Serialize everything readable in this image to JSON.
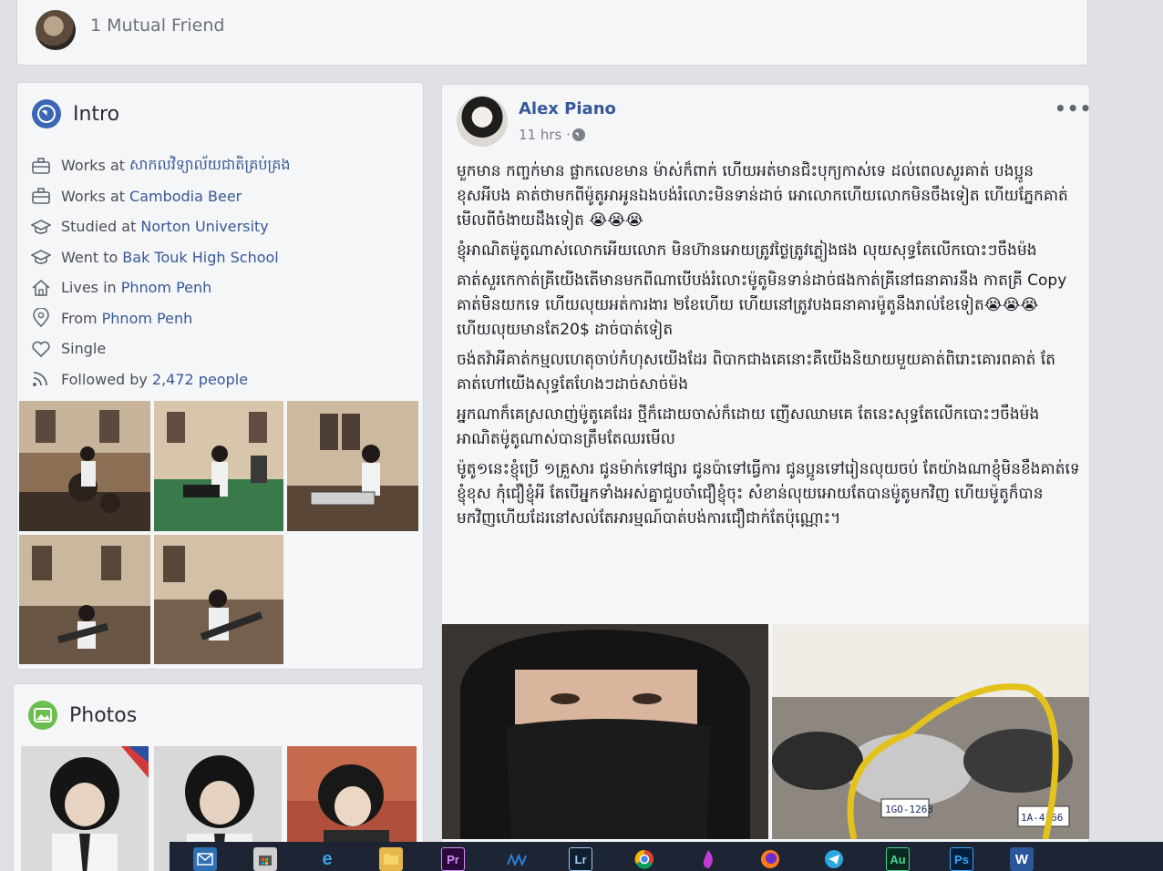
{
  "mutual": {
    "text": "1 Mutual Friend"
  },
  "intro": {
    "title": "Intro",
    "items": [
      {
        "icon": "briefcase-icon",
        "prefix": "Works at",
        "link": "សាកលវិទ្យាល័យជាតិគ្រប់គ្រង"
      },
      {
        "icon": "briefcase-icon",
        "prefix": "Works at",
        "link": "Cambodia Beer"
      },
      {
        "icon": "graduation-cap-icon",
        "prefix": "Studied at",
        "link": "Norton University"
      },
      {
        "icon": "graduation-cap-icon",
        "prefix": "Went to",
        "link": "Bak Touk High School"
      },
      {
        "icon": "home-icon",
        "prefix": "Lives in",
        "link": "Phnom Penh"
      },
      {
        "icon": "location-pin-icon",
        "prefix": "From",
        "link": "Phnom Penh"
      },
      {
        "icon": "heart-icon",
        "prefix": "Single",
        "link": ""
      },
      {
        "icon": "rss-feed-icon",
        "prefix": "Followed by",
        "link": "2,472 people"
      }
    ]
  },
  "photos": {
    "title": "Photos"
  },
  "post": {
    "author": "Alex Piano",
    "time": "11 hrs ·",
    "more": "•••",
    "paragraphs": [
      "មួកមាន កញ្ចក់មាន ផ្លាកលេខមាន ម៉ាស់ក៏ពាក់ ហើយអត់មានជិះបុក្យកាស់ទេ ដល់ពេលសួរគាត់ បងប្អូនខុសអីបង គាត់ថាមកពីម៉ូតូអាអូនឯងបង់រំលោះមិនទាន់ដាច់ អោលោកហើយលោកមិនចឹងទៀត ហើយភ្នែកគាត់មើលពីចំងាយដឹងទៀត 😭😭😭",
      "ខ្ញុំអាណិតម៉ូតូណាស់លោកអើយលោក មិនហ៊ានអោយត្រូវថ្ងៃត្រូវភ្លៀងផង លុយសុទ្ធតែលើកបោះៗចឹងម៉ង",
      "គាត់សួរកេកាត់គ្រីយើងតើមានមកពីណាបើបង់រំលោះម៉ូតូមិនទាន់ដាច់ផងកាត់គ្រីនៅធនាគារនឹង កាតគ្រី Copy គាត់មិនយកទេ ហើយលុយអត់ការងារ ២ខែហើយ ហើយនៅត្រូវបងធនាគារម៉ូតូនឹងរាល់ខែទៀត😭😭😭 ហើយលុយមានតែ20$ ដាច់បាត់ទៀត",
      "ចង់តវ៉ាអីគាត់កម្មលហេតុចាប់កំហុសយើងដែរ ពិបាកជាងគេនោះគឺយើងនិយាយមួយគាត់ពិរោះគោរពគាត់ តែគាត់ហៅយើងសុទ្ធតែហែងៗដាច់សាច់ម៉ង",
      "អ្នកណាក៏គេស្រលាញ់ម៉ូតូគេដែរ ថ្មីក៏ដោយចាស់ក៏ដោយ ញើសឈាមគេ តែនេះសុទ្ធតែលើកបោះៗចឹងម៉ង អាណិតម៉ូតូណាស់បានត្រឹមតែឈរមើល",
      "ម៉ូតូ១នេះខ្ញុំប្រើ ១គ្រួសារ ជូនម៉ាក់ទៅផ្សារ ជូនប៉ាទៅធ្វើការ ជូនប្អូនទៅរៀនលុយចប់ តែយ៉ាងណាខ្ញុំមិនខឹងគាត់ទេ ខ្ញុំខុស កុំជឿខ្ញុំអី តែបើអ្នកទាំងអស់គ្នាជួបចាំជឿខ្ញុំចុះ សំខាន់លុយអោយតែបានម៉ូតូមកវិញ ហើយម៉ូតូក៏បានមកវិញហើយដែរនៅសល់តែអារម្មណ៍បាត់បង់ការជឿជាក់តែប៉ុណ្ណោះ។"
    ],
    "photo_plates": [
      "1GO-1263",
      "1A-4166"
    ]
  },
  "taskbar": {
    "apps": [
      "Pr",
      "Lr",
      "Au",
      "Ps",
      "W"
    ]
  }
}
